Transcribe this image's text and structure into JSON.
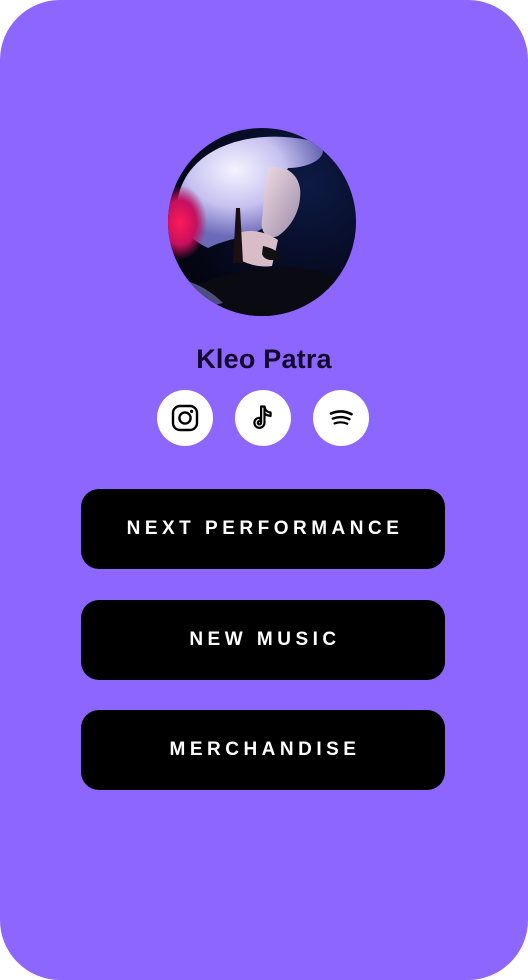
{
  "profile": {
    "name": "Kleo Patra",
    "avatar_alt": "Kleo Patra profile photo"
  },
  "socials": [
    {
      "icon": "instagram-icon"
    },
    {
      "icon": "tiktok-icon"
    },
    {
      "icon": "spotify-icon"
    }
  ],
  "links": [
    {
      "label": "NEXT PERFORMANCE"
    },
    {
      "label": "NEW MUSIC"
    },
    {
      "label": "MERCHANDISE"
    }
  ],
  "colors": {
    "background": "#8c66ff",
    "button": "#000000",
    "button_text": "#ffffff",
    "name_text": "#14072e",
    "social_bg": "#ffffff"
  }
}
